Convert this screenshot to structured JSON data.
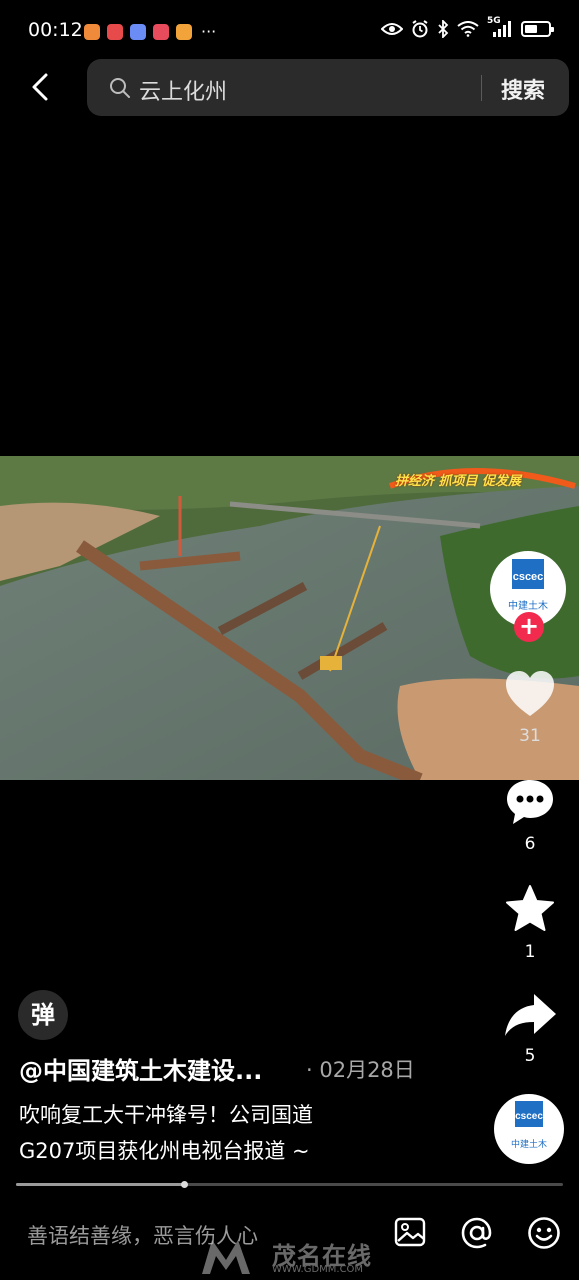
{
  "status_bar": {
    "time": "00:12",
    "app_icons": [
      {
        "name": "app-icon-1",
        "color": "#f08a3b"
      },
      {
        "name": "app-icon-2",
        "color": "#e64a4a"
      },
      {
        "name": "app-icon-3",
        "color": "#6b8cf5"
      },
      {
        "name": "app-icon-4",
        "color": "#e84b5b"
      },
      {
        "name": "app-icon-5",
        "color": "#f2a33a"
      }
    ],
    "more": "···",
    "network": "5G",
    "battery_level": 0.55
  },
  "header": {
    "search_query": "云上化州",
    "search_button": "搜索"
  },
  "video": {
    "overlay_text": "拼经济 抓项目 促发展"
  },
  "sidebar": {
    "avatar_text": "中建土木",
    "follow": "+",
    "likes": "31",
    "comments": "6",
    "favorites": "1",
    "shares": "5"
  },
  "post": {
    "danmu_label": "弹",
    "author": "@中国建筑土木建设...",
    "date": "· 02月28日",
    "description_line1": "吹响复工大干冲锋号！公司国道",
    "description_line2": "G207项目获化州电视台报道 ~",
    "music_disc_text": "中建土木"
  },
  "progress": {
    "value": 0.307
  },
  "comment_bar": {
    "placeholder": "善语结善缘，恶言伤人心"
  },
  "watermark": {
    "text": "茂名在线",
    "url": "WWW.GDMM.COM"
  },
  "colors": {
    "accent_red": "#f22a4e",
    "brand_blue": "#1f6fc5"
  }
}
